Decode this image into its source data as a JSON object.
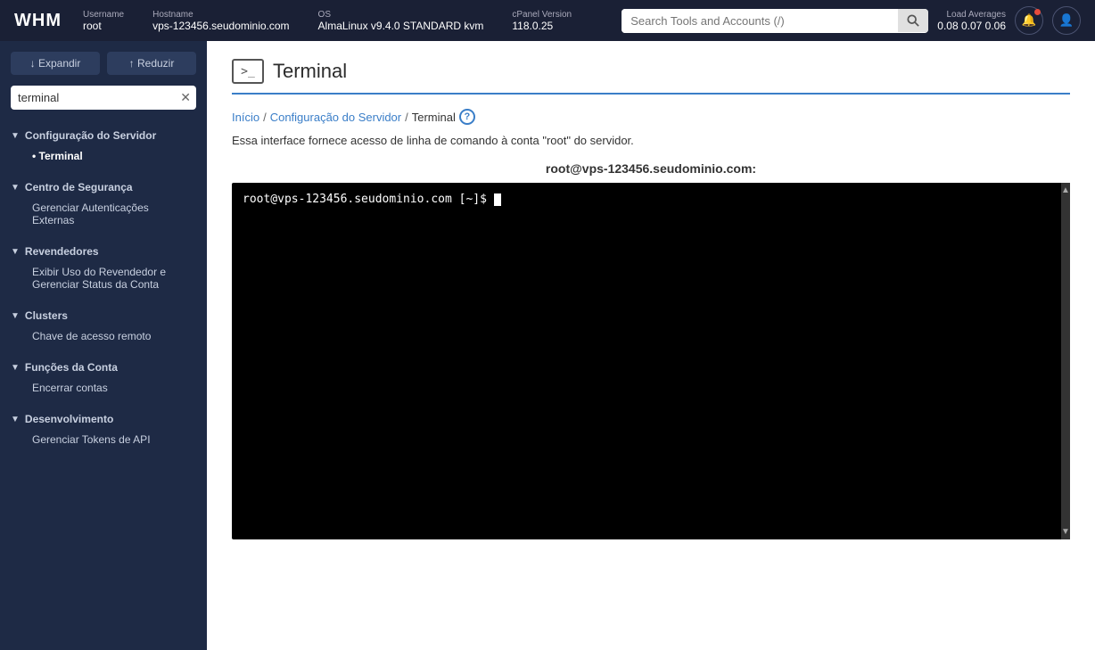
{
  "header": {
    "logo": "WHM",
    "meta": {
      "username_label": "Username",
      "username_value": "root",
      "hostname_label": "Hostname",
      "hostname_value": "vps-123456.seudominio.com",
      "os_label": "OS",
      "os_value": "AlmaLinux v9.4.0 STANDARD kvm",
      "cpanel_label": "cPanel Version",
      "cpanel_value": "118.0.25",
      "load_label": "Load Averages",
      "load_value": "0.08  0.07  0.06"
    },
    "search": {
      "placeholder": "Search Tools and Accounts (/)"
    }
  },
  "sidebar": {
    "expand_label": "↓ Expandir",
    "collapse_label": "↑ Reduzir",
    "search_value": "terminal",
    "sections": [
      {
        "id": "server-config",
        "label": "Configuração do Servidor",
        "expanded": true,
        "items": [
          {
            "id": "terminal",
            "label": "Terminal",
            "active": true
          }
        ]
      },
      {
        "id": "security-center",
        "label": "Centro de Segurança",
        "expanded": true,
        "items": [
          {
            "id": "manage-external-auth",
            "label": "Gerenciar Autenticações Externas",
            "active": false
          }
        ]
      },
      {
        "id": "resellers",
        "label": "Revendedores",
        "expanded": true,
        "items": [
          {
            "id": "reseller-usage",
            "label": "Exibir Uso do Revendedor e Gerenciar Status da Conta",
            "active": false
          }
        ]
      },
      {
        "id": "clusters",
        "label": "Clusters",
        "expanded": true,
        "items": [
          {
            "id": "remote-access",
            "label": "Chave de acesso remoto",
            "active": false
          }
        ]
      },
      {
        "id": "account-functions",
        "label": "Funções da Conta",
        "expanded": true,
        "items": [
          {
            "id": "terminate-accounts",
            "label": "Encerrar contas",
            "active": false
          }
        ]
      },
      {
        "id": "development",
        "label": "Desenvolvimento",
        "expanded": true,
        "items": [
          {
            "id": "manage-api-tokens",
            "label": "Gerenciar Tokens de API",
            "active": false
          }
        ]
      }
    ]
  },
  "content": {
    "page_title": "Terminal",
    "breadcrumb": {
      "home": "Início",
      "server_config": "Configuração do Servidor",
      "current": "Terminal"
    },
    "description": "Essa interface fornece acesso de linha de comando à conta \"root\" do servidor.",
    "terminal_heading": "root@vps-123456.seudominio.com:",
    "terminal_prompt": "root@vps-123456.seudominio.com [~]$ "
  }
}
